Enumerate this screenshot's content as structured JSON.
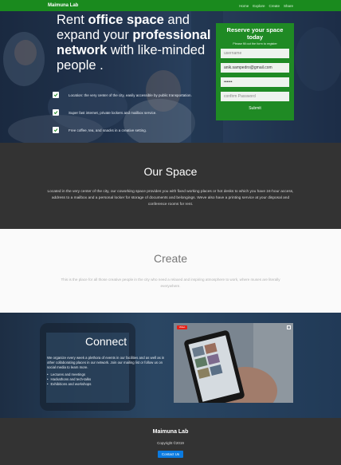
{
  "navbar": {
    "brand": "Maimuna Lab",
    "links": [
      "Home",
      "Explore",
      "Create",
      "Share"
    ]
  },
  "hero": {
    "title_part1": "Rent ",
    "title_bold1": "office space",
    "title_part2": " and expand your ",
    "title_bold2": "professional network",
    "title_part3": " with like-minded people .",
    "features": [
      "Location: the very center of the city, easily accessible by public transportation.",
      "Super fast internet, private lockers and mailbox service.",
      "Free coffee, tea, and snacks in a creative setting."
    ]
  },
  "signup": {
    "title": "Reserve your space today",
    "subtitle": "Please fill out the form to register",
    "username_placeholder": "username",
    "email_value": "anik.sampedro@gmail.com",
    "password_value": "••••••",
    "confirm_placeholder": "confirm Password",
    "submit_label": "Submit"
  },
  "space": {
    "title": "Our Space",
    "text": "Located in the very center of the city, our coworking space provides you with fixed working places or hot desks to which you have 24-hour access, address to a mailbox and a personal locker for storage of documents and belongings. Weve also have a printing service at your disposal and conference rooms for rent."
  },
  "create": {
    "title": "Create",
    "text": "This is the place for all those creative people in the city who need a relaxed and inspiring atmosphere to work, where muses are literally everywhere."
  },
  "connect": {
    "title": "Connect",
    "text": "We organize every week a plethora of events in our facilities and as well as in other collaborating places in our network. Join our mailing list or follow us on social media to learn more.",
    "list": [
      "Lectures and meetings",
      "Hackathons and tech-talks",
      "Exhibitions and workshops"
    ],
    "video_badge": "Video"
  },
  "footer": {
    "brand": "Maimuna Lab",
    "copyright": "Copyright ©2019",
    "contact_label": "Contact Us"
  },
  "colors": {
    "green": "#1f8a24",
    "dark": "#333333",
    "button_blue": "#0a7ae0"
  }
}
